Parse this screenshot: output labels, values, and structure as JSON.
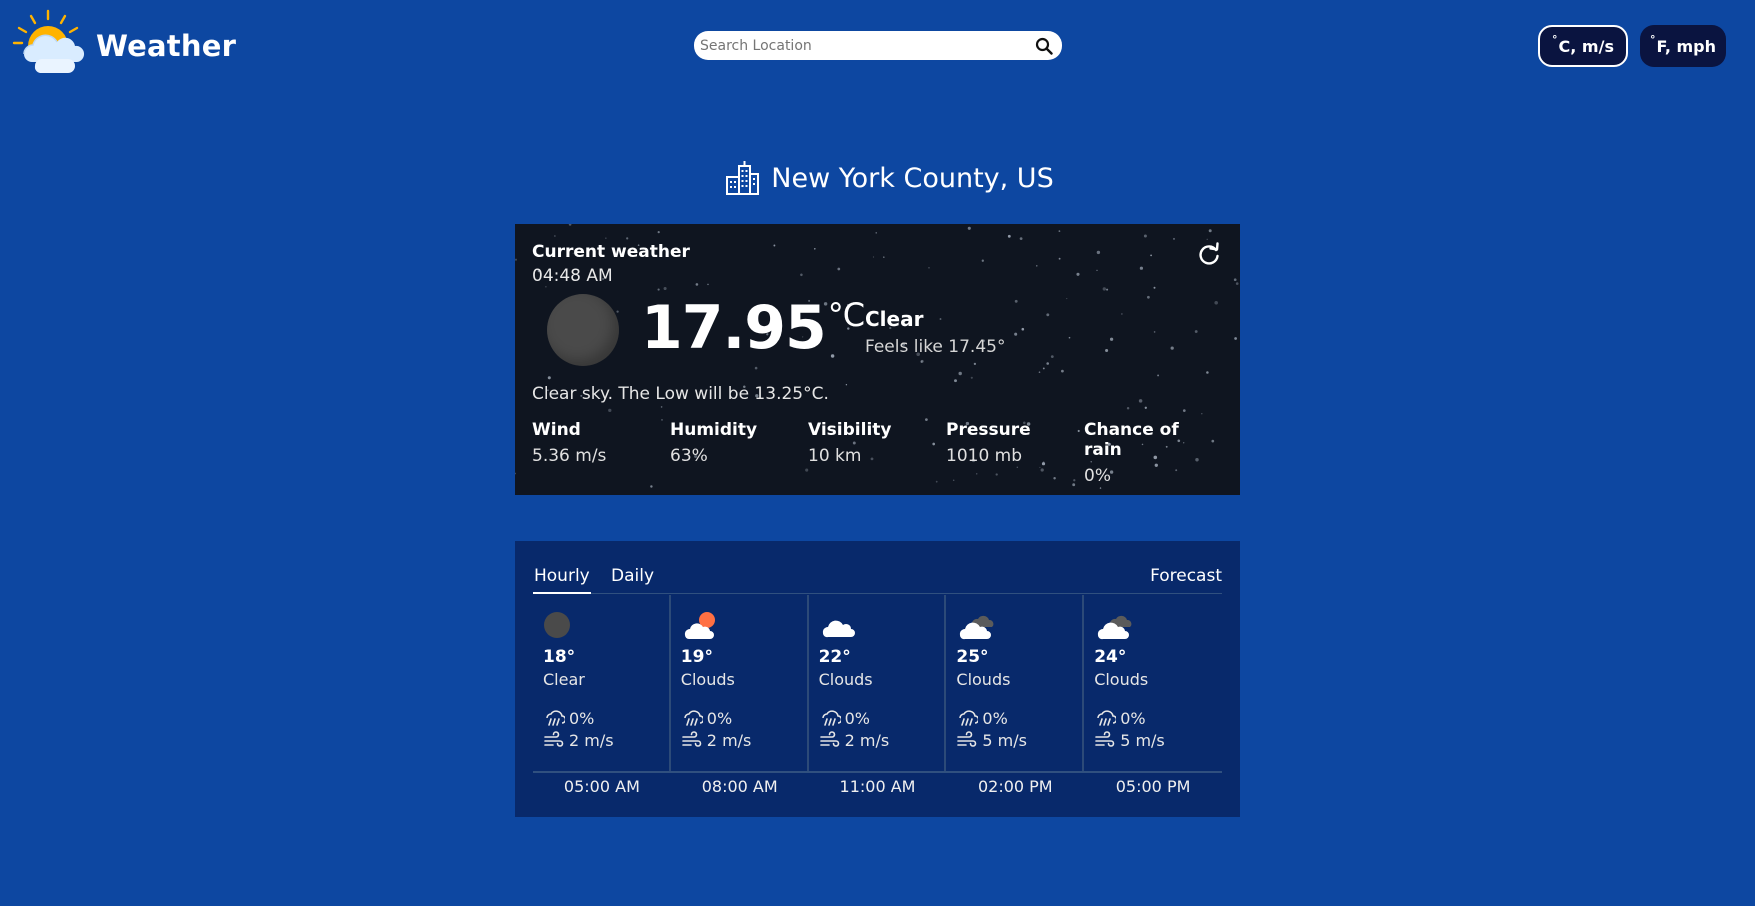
{
  "header": {
    "app_title": "Weather",
    "search_placeholder": "Search Location",
    "unit_metric_deg": "°",
    "unit_metric_label": "C, m/s",
    "unit_imperial_deg": "°",
    "unit_imperial_label": "F, mph",
    "selected_unit": "metric"
  },
  "location": {
    "name": "New York County, US"
  },
  "current": {
    "title": "Current weather",
    "time": "04:48 AM",
    "temperature": "17.95",
    "temperature_unit": "°C",
    "condition": "Clear",
    "feels_like": "Feels like 17.45°",
    "summary": "Clear sky. The Low will be 13.25°C.",
    "stats": [
      {
        "label": "Wind",
        "value": "5.36 m/s"
      },
      {
        "label": "Humidity",
        "value": "63%"
      },
      {
        "label": "Visibility",
        "value": "10 km"
      },
      {
        "label": "Pressure",
        "value": "1010 mb"
      },
      {
        "label": "Chance of rain",
        "value": "0%"
      }
    ]
  },
  "forecast": {
    "tabs": [
      {
        "label": "Hourly",
        "active": true
      },
      {
        "label": "Daily",
        "active": false
      }
    ],
    "title": "Forecast",
    "slots": [
      {
        "icon": "moon-icon",
        "temp": "18°",
        "condition": "Clear",
        "rain": "0%",
        "wind": "2 m/s",
        "time": "05:00 AM"
      },
      {
        "icon": "cloud-sun-icon",
        "temp": "19°",
        "condition": "Clouds",
        "rain": "0%",
        "wind": "2 m/s",
        "time": "08:00 AM"
      },
      {
        "icon": "cloud-icon",
        "temp": "22°",
        "condition": "Clouds",
        "rain": "0%",
        "wind": "2 m/s",
        "time": "11:00 AM"
      },
      {
        "icon": "broken-clouds-icon",
        "temp": "25°",
        "condition": "Clouds",
        "rain": "0%",
        "wind": "5 m/s",
        "time": "02:00 PM"
      },
      {
        "icon": "broken-clouds-icon",
        "temp": "24°",
        "condition": "Clouds",
        "rain": "0%",
        "wind": "5 m/s",
        "time": "05:00 PM"
      }
    ]
  },
  "colors": {
    "page_background": "#0d47a1",
    "current_card_background": "#0f1520",
    "forecast_card_background": "#08296b",
    "unit_button_background": "#0a1440",
    "sun": "#ffb300",
    "sunset_sun": "#ff7043"
  }
}
